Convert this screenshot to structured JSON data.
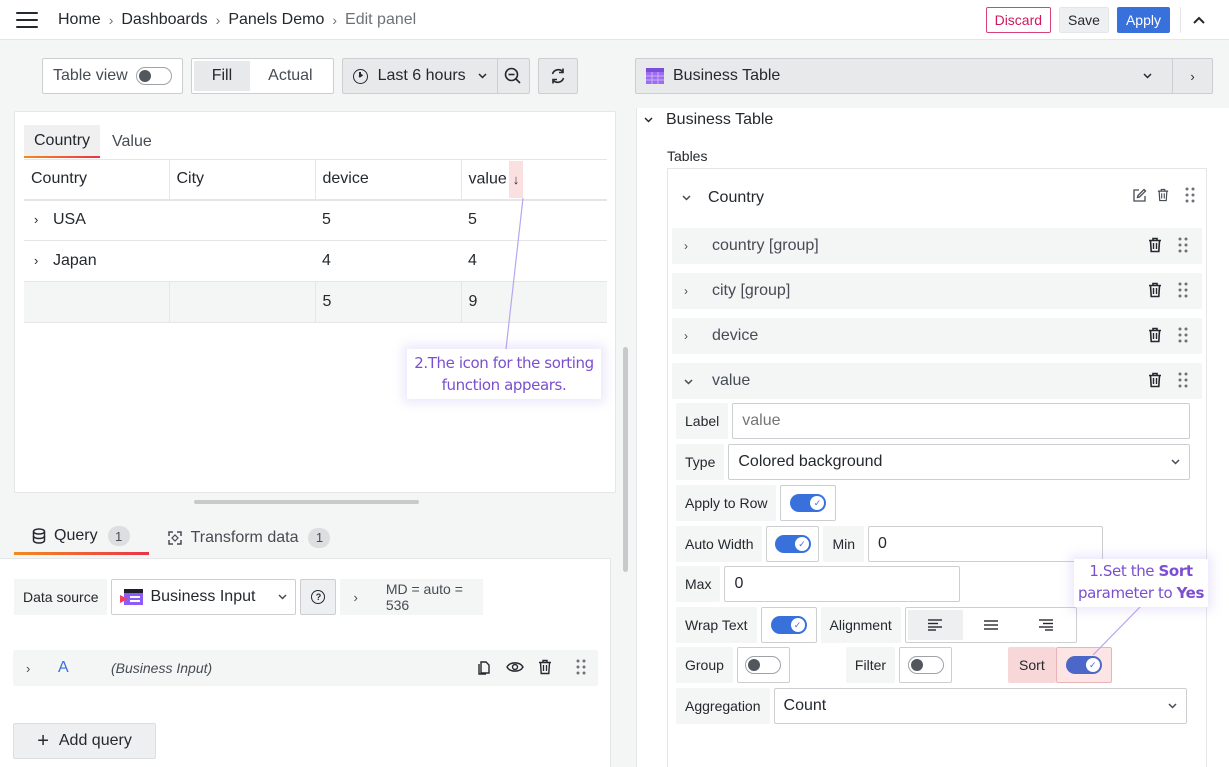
{
  "topbar": {
    "breadcrumb": [
      "Home",
      "Dashboards",
      "Panels Demo",
      "Edit panel"
    ],
    "discard_label": "Discard",
    "save_label": "Save",
    "apply_label": "Apply"
  },
  "toolbar": {
    "table_view_label": "Table view",
    "table_view_on": false,
    "fill_label": "Fill",
    "actual_label": "Actual",
    "active_mode": "Fill",
    "time_range": "Last 6 hours"
  },
  "panel": {
    "tabs": [
      {
        "label": "Country",
        "active": true
      },
      {
        "label": "Value",
        "active": false
      }
    ],
    "columns": [
      "Country",
      "City",
      "device",
      "value"
    ],
    "sort_icon": "arrow-down",
    "rows": [
      {
        "country": "USA",
        "city": "",
        "device": "5",
        "value": "5",
        "expandable": true
      },
      {
        "country": "Japan",
        "city": "",
        "device": "4",
        "value": "4",
        "expandable": true
      }
    ],
    "footer": {
      "country": "",
      "city": "",
      "device": "5",
      "value": "9"
    }
  },
  "annotations": {
    "callout_2": "2.The icon for the sorting function appears.",
    "callout_1_prefix": "1.Set the ",
    "callout_1_bold1": "Sort",
    "callout_1_mid": " parameter to ",
    "callout_1_bold2": "Yes",
    "accent_color": "#7b4fd0"
  },
  "query": {
    "tabs": [
      {
        "label": "Query",
        "count": "1",
        "active": true,
        "icon": "database-icon"
      },
      {
        "label": "Transform data",
        "count": "1",
        "active": false,
        "icon": "transform-icon"
      }
    ],
    "data_source_label": "Data source",
    "data_source_value": "Business Input",
    "options_summary": "MD = auto = 536",
    "queries": [
      {
        "name": "A",
        "datasource": "(Business Input)"
      }
    ],
    "add_query_label": "Add query"
  },
  "options": {
    "visualization": "Business Table",
    "section_title": "Business Table",
    "tables_label": "Tables",
    "table_group": "Country",
    "columns": [
      {
        "name": "country [group]",
        "expanded": false
      },
      {
        "name": "city [group]",
        "expanded": false
      },
      {
        "name": "device",
        "expanded": false
      },
      {
        "name": "value",
        "expanded": true
      }
    ],
    "value_editor": {
      "label_label": "Label",
      "label_placeholder": "value",
      "type_label": "Type",
      "type_value": "Colored background",
      "apply_to_row_label": "Apply to Row",
      "apply_to_row": true,
      "auto_width_label": "Auto Width",
      "auto_width": true,
      "min_label": "Min",
      "min_value": "0",
      "max_label": "Max",
      "max_value": "0",
      "wrap_text_label": "Wrap Text",
      "wrap_text": true,
      "alignment_label": "Alignment",
      "alignment_options": [
        "left",
        "center",
        "right"
      ],
      "alignment_value": "left",
      "group_label": "Group",
      "group": false,
      "filter_label": "Filter",
      "filter": false,
      "sort_label": "Sort",
      "sort": true,
      "aggregation_label": "Aggregation",
      "aggregation_value": "Count"
    }
  }
}
